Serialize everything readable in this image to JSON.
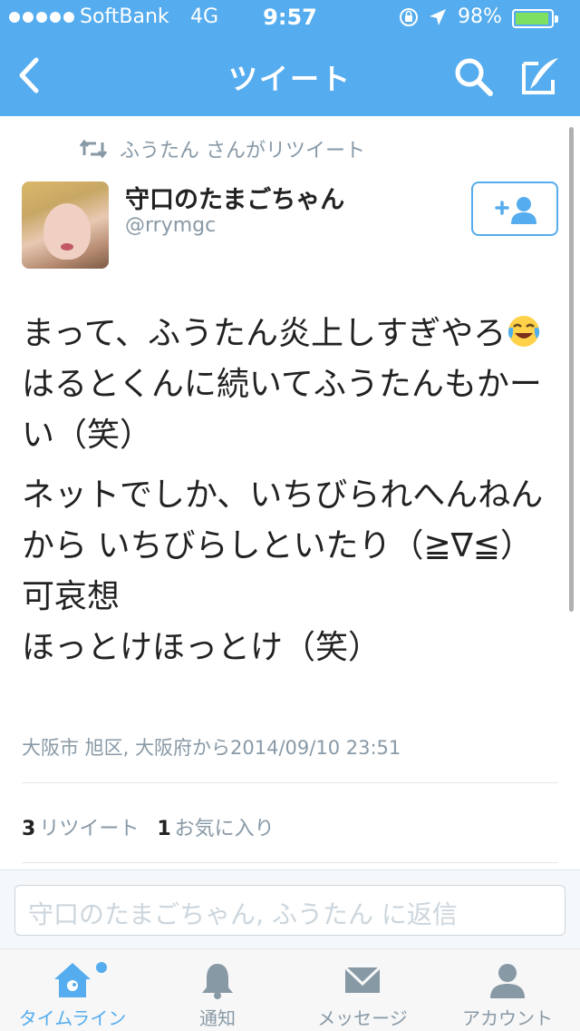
{
  "status_bar": {
    "carrier": "SoftBank",
    "network": "4G",
    "time": "9:57",
    "battery": "98%",
    "battery_level": 0.98
  },
  "nav": {
    "title": "ツイート",
    "back_icon": "chevron-left-icon",
    "search_icon": "search-icon",
    "compose_icon": "compose-icon"
  },
  "tweet": {
    "retweeted_by": "ふうたん さんがリツイート",
    "display_name": "守口のたまごちゃん",
    "screen_name": "@rrymgc",
    "paragraphs": [
      "まって、ふうたん炎上しすぎやろ",
      "はるとくんに続いてふうたんもかーい（笑）",
      "ネットでしか、いちびられへんねんから いちびらしといたり（≧∇≦）可哀想",
      "ほっとけほっとけ（笑）"
    ],
    "emoji": "face-with-tears-of-joy",
    "location_time": "大阪市 旭区, 大阪府から2014/09/10 23:51",
    "retweets_count": "3",
    "retweets_label": "リツイート",
    "favorites_count": "1",
    "favorites_label": "お気に入り"
  },
  "reply": {
    "placeholder": "守口のたまごちゃん, ふうたん に返信"
  },
  "tabs": [
    {
      "label": "タイムライン",
      "icon": "home-icon",
      "active": true
    },
    {
      "label": "通知",
      "icon": "bell-icon",
      "active": false
    },
    {
      "label": "メッセージ",
      "icon": "envelope-icon",
      "active": false
    },
    {
      "label": "アカウント",
      "icon": "person-icon",
      "active": false
    }
  ],
  "colors": {
    "brand": "#55acee",
    "muted": "#8899a6",
    "text": "#222222"
  }
}
